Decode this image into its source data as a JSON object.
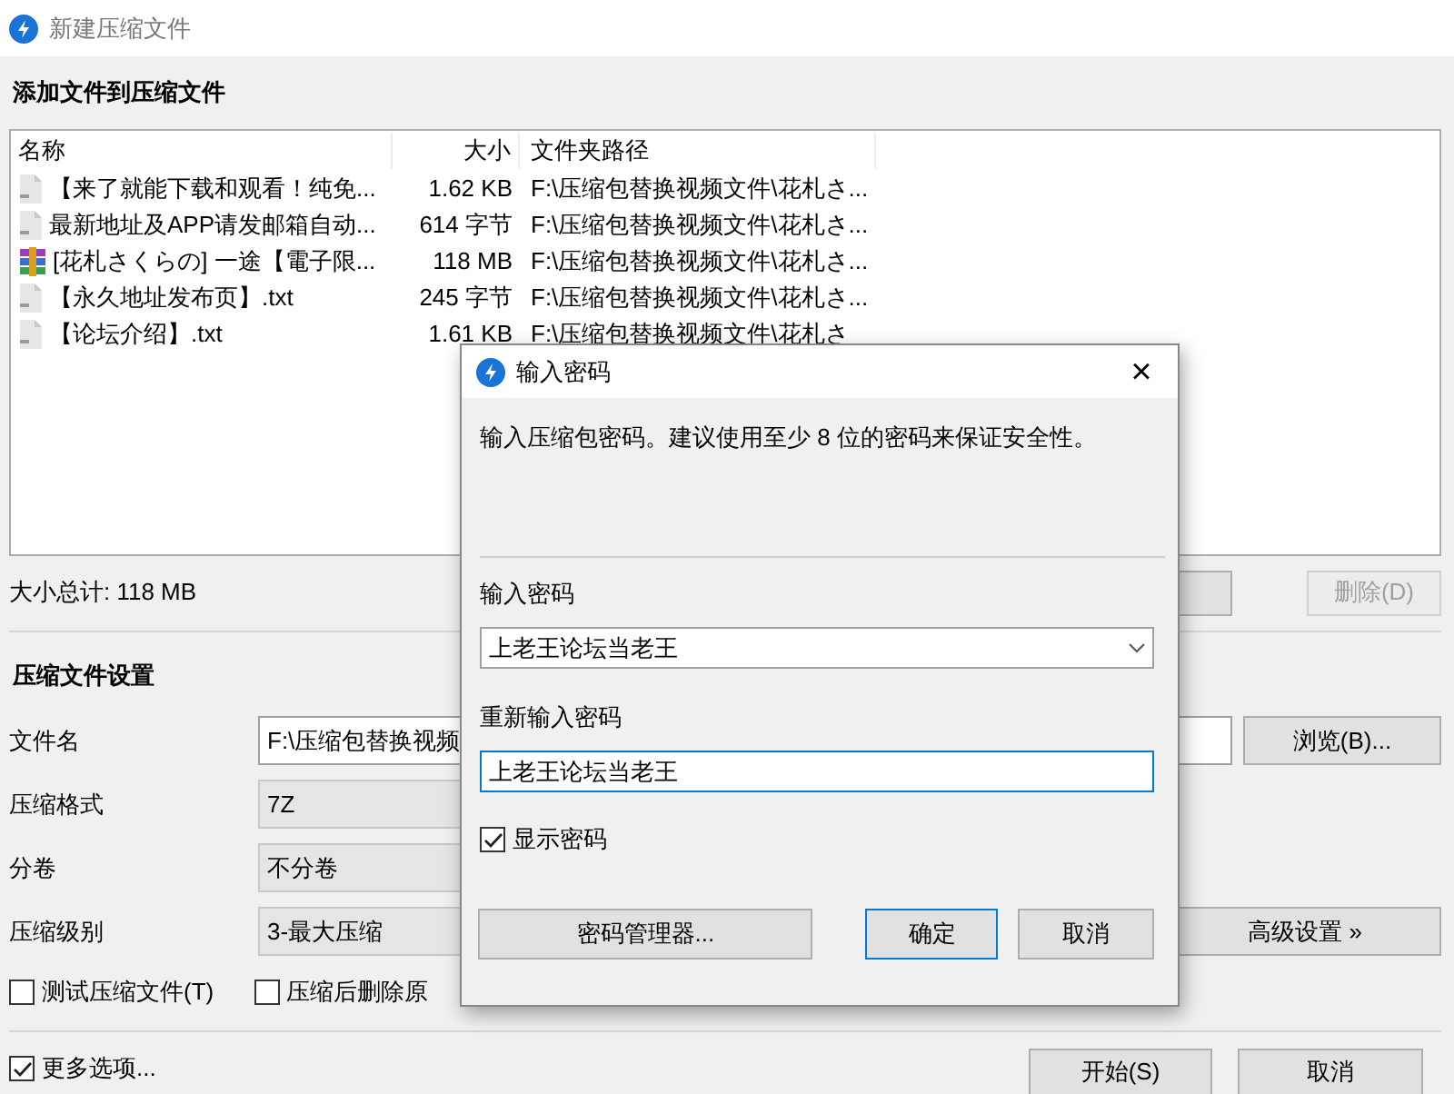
{
  "window": {
    "title": "新建压缩文件"
  },
  "files_section": {
    "title": "添加文件到压缩文件",
    "columns": [
      "名称",
      "大小",
      "文件夹路径"
    ],
    "rows": [
      {
        "kind": "text",
        "name": "【来了就能下载和观看！纯免...",
        "size": "1.62 KB",
        "path": "F:\\压缩包替换视频文件\\花札さ..."
      },
      {
        "kind": "text",
        "name": "最新地址及APP请发邮箱自动...",
        "size": "614 字节",
        "path": "F:\\压缩包替换视频文件\\花札さ..."
      },
      {
        "kind": "archive",
        "name": "[花札さくらの] 一途【電子限...",
        "size": "118 MB",
        "path": "F:\\压缩包替换视频文件\\花札さ..."
      },
      {
        "kind": "text",
        "name": "【永久地址发布页】.txt",
        "size": "245 字节",
        "path": "F:\\压缩包替换视频文件\\花札さ..."
      },
      {
        "kind": "text",
        "name": "【论坛介绍】.txt",
        "size": "1.61 KB",
        "path": "F:\\压缩包替换视频文件\\花札さ"
      }
    ],
    "total": "大小总计: 118 MB",
    "delete_button": {
      "label": "删除(D)",
      "disabled": true
    }
  },
  "settings": {
    "title": "压缩文件设置",
    "fields": [
      {
        "kind": "text",
        "label": "文件名",
        "value": "F:\\压缩包替换视频",
        "button": "浏览(B)..."
      },
      {
        "kind": "select",
        "label": "压缩格式",
        "value": "7Z"
      },
      {
        "kind": "select",
        "label": "分卷",
        "value": "不分卷"
      },
      {
        "kind": "select",
        "label": "压缩级别",
        "value": "3-最大压缩",
        "button": "高级设置 »"
      }
    ],
    "options": [
      {
        "label": "测试压缩文件(T)",
        "checked": false
      },
      {
        "label": "压缩后删除原",
        "checked": false
      }
    ]
  },
  "footer": {
    "more_options": {
      "label": "更多选项...",
      "checked": true
    },
    "buttons": [
      "开始(S)",
      "取消"
    ]
  },
  "dialog": {
    "title": "输入密码",
    "close": "×",
    "message": "输入压缩包密码。建议使用至少 8 位的密码来保证安全性。",
    "password": {
      "label": "输入密码",
      "value": "上老王论坛当老王"
    },
    "confirm": {
      "label": "重新输入密码",
      "value": "上老王论坛当老王"
    },
    "show_password": {
      "label": "显示密码",
      "checked": true
    },
    "buttons": [
      {
        "label": "密码管理器...",
        "default": false
      },
      {
        "label": "确定",
        "default": true
      },
      {
        "label": "取消",
        "default": false
      }
    ]
  }
}
